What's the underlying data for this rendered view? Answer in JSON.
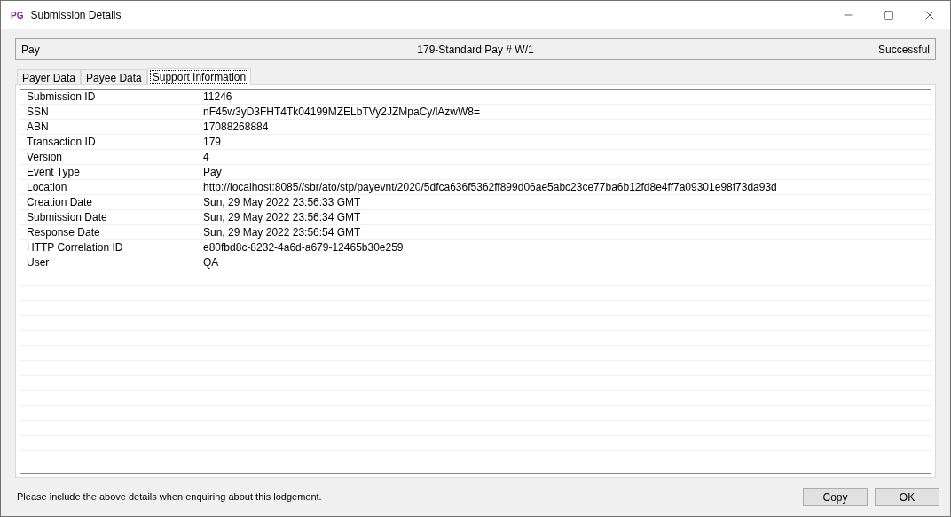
{
  "window": {
    "title": "Submission Details",
    "logo": "PG"
  },
  "header": {
    "left": "Pay",
    "center": "179-Standard Pay # W/1",
    "right": "Successful"
  },
  "tabs": [
    {
      "label": "Payer Data",
      "selected": false
    },
    {
      "label": "Payee Data",
      "selected": false
    },
    {
      "label": "Support Information",
      "selected": true
    }
  ],
  "rows": [
    {
      "name": "Submission ID",
      "value": "11246"
    },
    {
      "name": "SSN",
      "value": "nF45w3yD3FHT4Tk04199MZELbTVy2JZMpaCy/lAzwW8="
    },
    {
      "name": "ABN",
      "value": "17088268884"
    },
    {
      "name": "Transaction ID",
      "value": "179"
    },
    {
      "name": "Version",
      "value": "4"
    },
    {
      "name": "Event Type",
      "value": "Pay"
    },
    {
      "name": "Location",
      "value": "http://localhost:8085//sbr/ato/stp/payevnt/2020/5dfca636f5362ff899d06ae5abc23ce77ba6b12fd8e4ff7a09301e98f73da93d"
    },
    {
      "name": "Creation Date",
      "value": "Sun, 29 May 2022 23:56:33 GMT"
    },
    {
      "name": "Submission Date",
      "value": "Sun, 29 May 2022 23:56:34 GMT"
    },
    {
      "name": "Response Date",
      "value": "Sun, 29 May 2022 23:56:54 GMT"
    },
    {
      "name": "HTTP Correlation ID",
      "value": "e80fbd8c-8232-4a6d-a679-12465b30e259"
    },
    {
      "name": "User",
      "value": "QA"
    }
  ],
  "footer": {
    "note": "Please include the above details when enquiring about this lodgement.",
    "buttons": [
      "Copy",
      "OK"
    ]
  }
}
